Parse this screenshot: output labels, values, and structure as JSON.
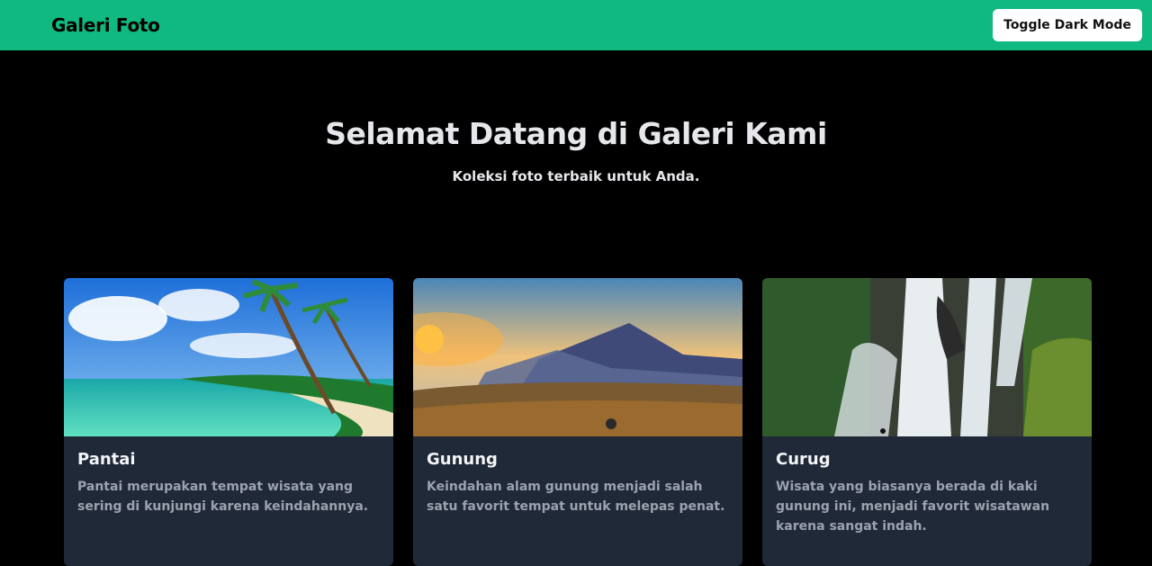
{
  "nav": {
    "brand": "Galeri Foto",
    "toggle_label": "Toggle Dark Mode"
  },
  "hero": {
    "title": "Selamat Datang di Galeri Kami",
    "subtitle": "Koleksi foto terbaik untuk Anda."
  },
  "cards": [
    {
      "title": "Pantai",
      "description": "Pantai merupakan tempat wisata yang sering di kunjungi karena keindahannya."
    },
    {
      "title": "Gunung",
      "description": "Keindahan alam gunung menjadi salah satu favorit tempat untuk melepas penat."
    },
    {
      "title": "Curug",
      "description": "Wisata yang biasanya berada di kaki gunung ini, menjadi favorit wisatawan karena sangat indah."
    }
  ],
  "colors": {
    "nav_bg": "#10b981",
    "page_bg": "#000000",
    "card_bg": "#1f2937"
  }
}
